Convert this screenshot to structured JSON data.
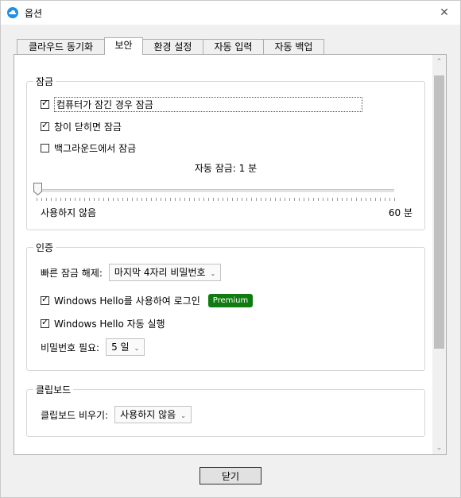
{
  "window": {
    "title": "옵션",
    "close_icon": "close-icon"
  },
  "tabs": [
    {
      "label": "클라우드 동기화",
      "active": false
    },
    {
      "label": "보안",
      "active": true
    },
    {
      "label": "환경 설정",
      "active": false
    },
    {
      "label": "자동 입력",
      "active": false
    },
    {
      "label": "자동 백업",
      "active": false
    }
  ],
  "lock": {
    "title": "잠금",
    "options": [
      {
        "label": "컴퓨터가 잠긴 경우 잠금",
        "checked": true
      },
      {
        "label": "창이 닫히면 잠금",
        "checked": true
      },
      {
        "label": "백그라운드에서 잠금",
        "checked": false
      }
    ],
    "autolock_label": "자동 잠금: 1 분",
    "slider_min_label": "사용하지 않음",
    "slider_max_label": "60 분",
    "slider_value_minutes": 1
  },
  "auth": {
    "title": "인증",
    "quick_unlock_label": "빠른 잠금 해제:",
    "quick_unlock_value": "마지막 4자리 비밀번호",
    "hello_login_label": "Windows Hello를 사용하여 로그인",
    "hello_login_checked": true,
    "premium_badge": "Premium",
    "hello_auto_label": "Windows Hello 자동 실행",
    "hello_auto_checked": true,
    "password_required_label": "비밀번호 필요:",
    "password_required_value": "5 일"
  },
  "clipboard": {
    "title": "클립보드",
    "clear_label": "클립보드 비우기:",
    "clear_value": "사용하지 않음"
  },
  "footer": {
    "close_label": "닫기"
  },
  "colors": {
    "accent": "#1e90e8",
    "premium": "#107c10"
  }
}
